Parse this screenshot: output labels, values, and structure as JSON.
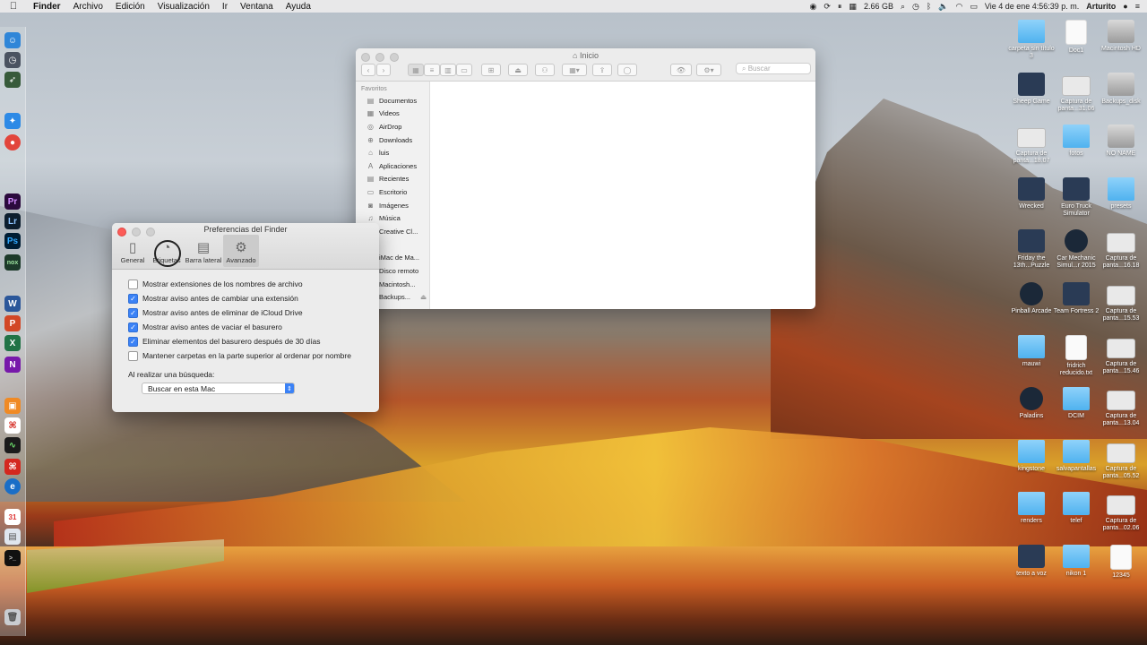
{
  "menubar": {
    "apple": "",
    "items": [
      "Finder",
      "Archivo",
      "Edición",
      "Visualización",
      "Ir",
      "Ventana",
      "Ayuda"
    ],
    "status": {
      "memory": "2.66 GB",
      "datetime": "Vie 4 de ene  4:56:39 p. m.",
      "user": "Arturito"
    }
  },
  "finder_window": {
    "title": "Inicio",
    "search_placeholder": "Buscar",
    "sidebar": {
      "section_favorites": "Favoritos",
      "favorites": [
        "Documentos",
        "Videos",
        "AirDrop",
        "Downloads",
        "luis",
        "Aplicaciones",
        "Recientes",
        "Escritorio",
        "Imágenes",
        "Música",
        "Creative Cl..."
      ],
      "section_devices": "sitivos",
      "devices": [
        "iMac de Ma...",
        "Disco remoto",
        "Macintosh...",
        "Backups..."
      ]
    }
  },
  "prefs_window": {
    "title": "Preferencias del Finder",
    "tabs": [
      "General",
      "Etiquetas",
      "Barra lateral",
      "Avanzado"
    ],
    "selected_tab": "Avanzado",
    "options": [
      {
        "label": "Mostrar extensiones de los nombres de archivo",
        "checked": false
      },
      {
        "label": "Mostrar aviso antes de cambiar una extensión",
        "checked": true
      },
      {
        "label": "Mostrar aviso antes de eliminar de iCloud Drive",
        "checked": true
      },
      {
        "label": "Mostrar aviso antes de vaciar el basurero",
        "checked": true
      },
      {
        "label": "Eliminar elementos del basurero después de 30 días",
        "checked": true
      },
      {
        "label": "Mantener carpetas en la parte superior al ordenar por nombre",
        "checked": false
      }
    ],
    "search_label": "Al realizar una búsqueda:",
    "search_select": "Buscar en esta Mac"
  },
  "desktop_icons": [
    {
      "label": "carpeta sin título 3",
      "kind": "folder"
    },
    {
      "label": "Doc1",
      "kind": "doc"
    },
    {
      "label": "Macintosh HD",
      "kind": "drive"
    },
    {
      "label": "Sheep Game",
      "kind": "app"
    },
    {
      "label": "Captura de panta...31.06",
      "kind": "shot"
    },
    {
      "label": "Backups_disk",
      "kind": "drive"
    },
    {
      "label": "Captura de panta...18.07",
      "kind": "shot"
    },
    {
      "label": "fotos",
      "kind": "folder"
    },
    {
      "label": "NO NAME",
      "kind": "drive"
    },
    {
      "label": "Wrecked",
      "kind": "app"
    },
    {
      "label": "Euro Truck Simulator",
      "kind": "app"
    },
    {
      "label": "presets",
      "kind": "folder"
    },
    {
      "label": "Friday the 13th...Puzzle",
      "kind": "app"
    },
    {
      "label": "Car Mechanic Simul...r 2015",
      "kind": "steam"
    },
    {
      "label": "Captura de panta...16.18",
      "kind": "shot"
    },
    {
      "label": "Pinball Arcade",
      "kind": "steam"
    },
    {
      "label": "Team Fortress 2",
      "kind": "app"
    },
    {
      "label": "Captura de panta...15.53",
      "kind": "shot"
    },
    {
      "label": "mauwi",
      "kind": "folder"
    },
    {
      "label": "fridrich reducido.txt",
      "kind": "doc"
    },
    {
      "label": "Captura de panta...15.46",
      "kind": "shot"
    },
    {
      "label": "Paladins",
      "kind": "steam"
    },
    {
      "label": "DCIM",
      "kind": "folder"
    },
    {
      "label": "Captura de panta...13.04",
      "kind": "shot"
    },
    {
      "label": "kingstone",
      "kind": "folder"
    },
    {
      "label": "salvapantallas",
      "kind": "folder"
    },
    {
      "label": "Captura de panta...05.52",
      "kind": "shot"
    },
    {
      "label": "renders",
      "kind": "folder"
    },
    {
      "label": "telef",
      "kind": "folder"
    },
    {
      "label": "Captura de panta...02.06",
      "kind": "shot"
    },
    {
      "label": "texto a voz",
      "kind": "app"
    },
    {
      "label": "nikon 1",
      "kind": "folder"
    },
    {
      "label": "12345",
      "kind": "doc"
    }
  ],
  "dock_apps": [
    "Finder",
    "Time Machine",
    "Rocket",
    "Safari",
    "Chrome",
    "Pr",
    "Lr",
    "Ps",
    "nox",
    "W",
    "P",
    "X",
    "N",
    "Books",
    "Acrobat",
    "Activity",
    "Acrobat DC",
    "Edge",
    "Calendar",
    "Preview",
    "Terminal",
    "Trash"
  ]
}
